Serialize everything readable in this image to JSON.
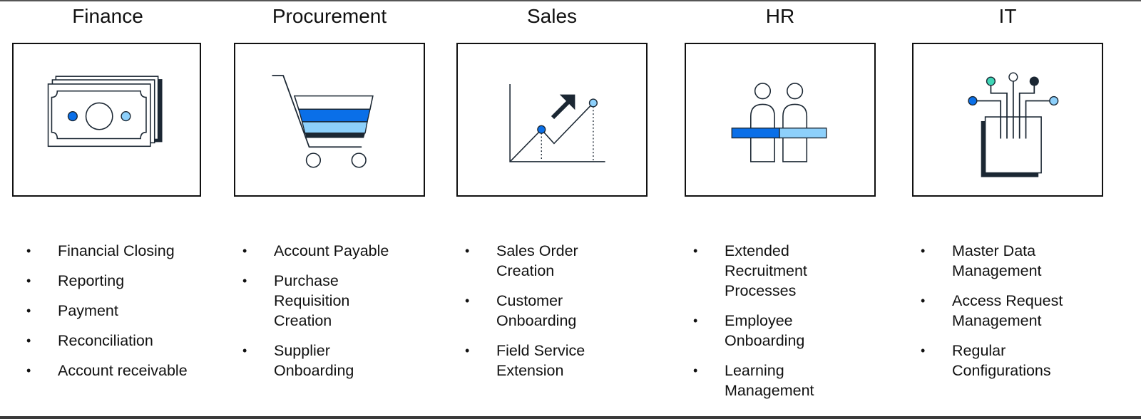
{
  "colors": {
    "stroke": "#1b2733",
    "blue": "#0a6fe8",
    "light_blue": "#8dd0fb",
    "teal": "#3fd6b6",
    "navy": "#1b2733"
  },
  "bullet_glyph": "•",
  "columns": [
    {
      "title": "Finance",
      "icon": "money-stack-icon",
      "items": [
        "Financial Closing",
        "Reporting",
        "Payment",
        "Reconciliation",
        "Account receivable"
      ]
    },
    {
      "title": "Procurement",
      "icon": "shopping-cart-icon",
      "items": [
        "Account Payable",
        "Purchase\nRequisition\nCreation",
        "Supplier\nOnboarding"
      ]
    },
    {
      "title": "Sales",
      "icon": "growth-chart-icon",
      "items": [
        "Sales Order\nCreation",
        "Customer\nOnboarding",
        "Field Service\nExtension"
      ]
    },
    {
      "title": "HR",
      "icon": "people-icon",
      "items": [
        "Extended\nRecruitment\nProcesses",
        "Employee\nOnboarding",
        "Learning\nManagement"
      ]
    },
    {
      "title": "IT",
      "icon": "circuit-chip-icon",
      "items": [
        "Master Data\nManagement",
        "Access Request\nManagement",
        "Regular\nConfigurations"
      ]
    }
  ]
}
